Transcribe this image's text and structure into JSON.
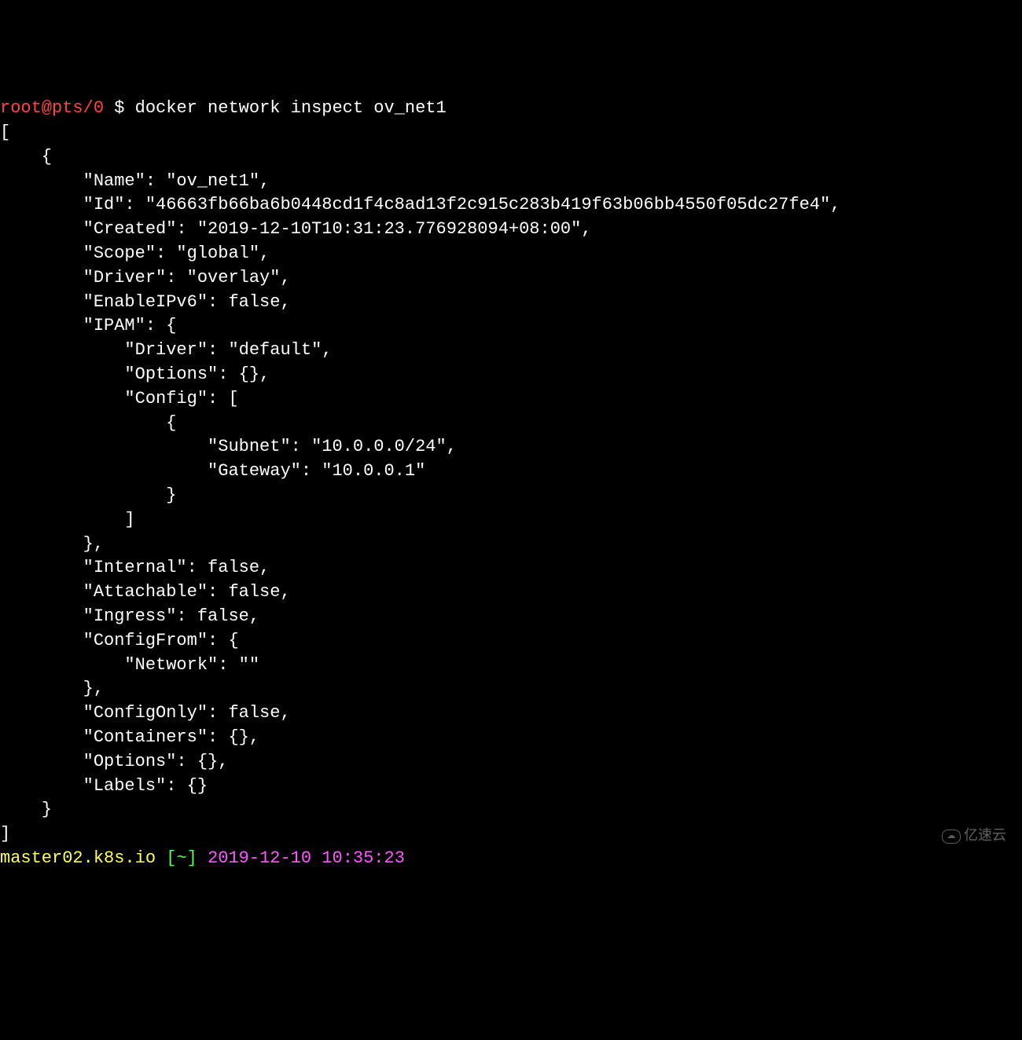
{
  "prompt1": {
    "user": "root@pts/0",
    "dollar": " $ ",
    "command": "docker network inspect ov_net1"
  },
  "output": {
    "line01": "[",
    "line02": "    {",
    "line03": "        \"Name\": \"ov_net1\",",
    "line04": "        \"Id\": \"46663fb66ba6b0448cd1f4c8ad13f2c915c283b419f63b06bb4550f05dc27fe4\",",
    "line05": "        \"Created\": \"2019-12-10T10:31:23.776928094+08:00\",",
    "line06": "        \"Scope\": \"global\",",
    "line07": "        \"Driver\": \"overlay\",",
    "line08": "        \"EnableIPv6\": false,",
    "line09": "        \"IPAM\": {",
    "line10": "            \"Driver\": \"default\",",
    "line11": "            \"Options\": {},",
    "line12": "            \"Config\": [",
    "line13": "                {",
    "line14": "                    \"Subnet\": \"10.0.0.0/24\",",
    "line15": "                    \"Gateway\": \"10.0.0.1\"",
    "line16": "                }",
    "line17": "            ]",
    "line18": "        },",
    "line19": "        \"Internal\": false,",
    "line20": "        \"Attachable\": false,",
    "line21": "        \"Ingress\": false,",
    "line22": "        \"ConfigFrom\": {",
    "line23": "            \"Network\": \"\"",
    "line24": "        },",
    "line25": "        \"ConfigOnly\": false,",
    "line26": "        \"Containers\": {},",
    "line27": "        \"Options\": {},",
    "line28": "        \"Labels\": {}",
    "line29": "    }",
    "line30": "]"
  },
  "prompt2": {
    "hostname": "master02.k8s.io",
    "path": " [~] ",
    "timestamp": "2019-12-10 10:35:23"
  },
  "watermark": "亿速云"
}
